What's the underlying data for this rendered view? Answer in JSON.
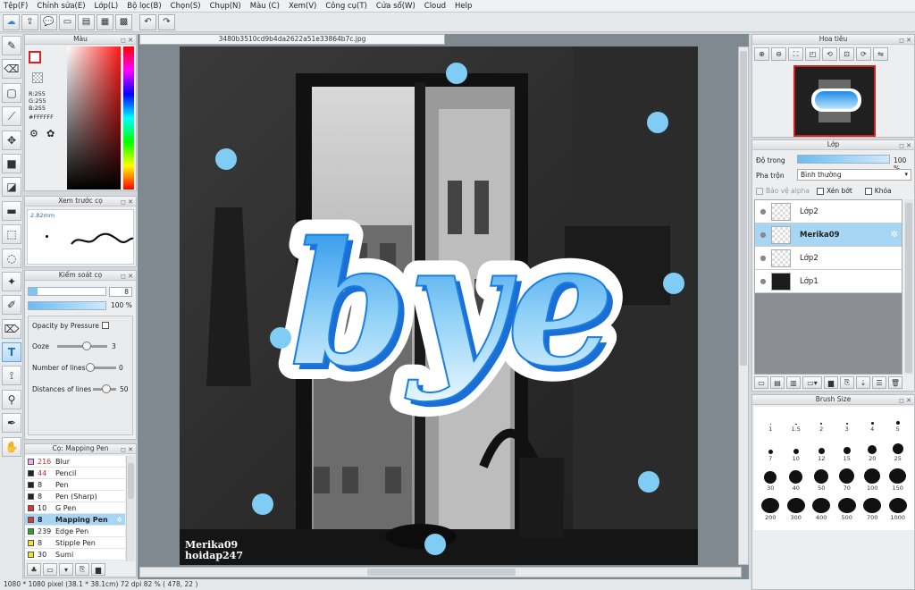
{
  "menu": [
    "Tệp(F)",
    "Chỉnh sửa(E)",
    "Lớp(L)",
    "Bộ lọc(B)",
    "Chọn(S)",
    "Chụp(N)",
    "Màu (C)",
    "Xem(V)",
    "Công cụ(T)",
    "Cửa sổ(W)",
    "Cloud",
    "Help"
  ],
  "document": {
    "tab_title": "3480b3510cd9b4da2622a51e33864b7c.jpg"
  },
  "color_panel": {
    "title": "Màu",
    "r": "R:255",
    "g": "G:255",
    "b": "B:255",
    "hex": "#FFFFFF"
  },
  "brush_preview": {
    "title": "Xem trước cọ",
    "size": "2.82mm"
  },
  "brush_control": {
    "title": "Kiểm soát cọ",
    "size_value": "8",
    "opacity_value": "100 %",
    "opacity_pressure_label": "Opacity by Pressure",
    "ooze_label": "Ooze",
    "ooze_value": "3",
    "lines_label": "Number of lines",
    "lines_value": "0",
    "distance_label": "Distances of lines",
    "distance_value": "50"
  },
  "brush_list": {
    "title": "Cọ: Mapping Pen",
    "items": [
      {
        "num": "216",
        "name": "Blur",
        "color": "#f4a7f4"
      },
      {
        "num": "44",
        "name": "Pencil",
        "color": "#222222"
      },
      {
        "num": "8",
        "name": "Pen",
        "color": "#222222"
      },
      {
        "num": "8",
        "name": "Pen (Sharp)",
        "color": "#222222"
      },
      {
        "num": "10",
        "name": "G Pen",
        "color": "#e53030"
      },
      {
        "num": "8",
        "name": "Mapping Pen",
        "color": "#e53030"
      },
      {
        "num": "239",
        "name": "Edge Pen",
        "color": "#2aa52a"
      },
      {
        "num": "8",
        "name": "Stipple Pen",
        "color": "#f1e22a"
      },
      {
        "num": "30",
        "name": "Sumi",
        "color": "#f1e22a"
      }
    ]
  },
  "artwork": {
    "title_text": "bye",
    "watermark_line1": "Merika09",
    "watermark_line2": "hoidap247"
  },
  "status": {
    "text": "1080 * 1080 pixel  (38.1 * 38.1cm)  72 dpi  82 %  ( 478, 22 )"
  },
  "navigator": {
    "title": "Hoa tiêu"
  },
  "layers": {
    "title": "Lớp",
    "opacity_label": "Độ trong",
    "opacity_value": "100 %",
    "blend_label": "Pha trộn",
    "blend_value": "Bình thường",
    "protect_alpha": "Bảo vệ alpha",
    "clipping": "Xén bớt",
    "lock": "Khóa",
    "items": [
      {
        "name": "Lớp2"
      },
      {
        "name": "Merika09"
      },
      {
        "name": "Lớp2"
      },
      {
        "name": "Lớp1"
      }
    ]
  },
  "brush_size": {
    "title": "Brush Size",
    "sizes": [
      "1",
      "1.5",
      "2",
      "3",
      "4",
      "5",
      "7",
      "10",
      "12",
      "15",
      "20",
      "25",
      "30",
      "40",
      "50",
      "70",
      "100",
      "150",
      "200",
      "300",
      "400",
      "500",
      "700",
      "1000"
    ]
  }
}
